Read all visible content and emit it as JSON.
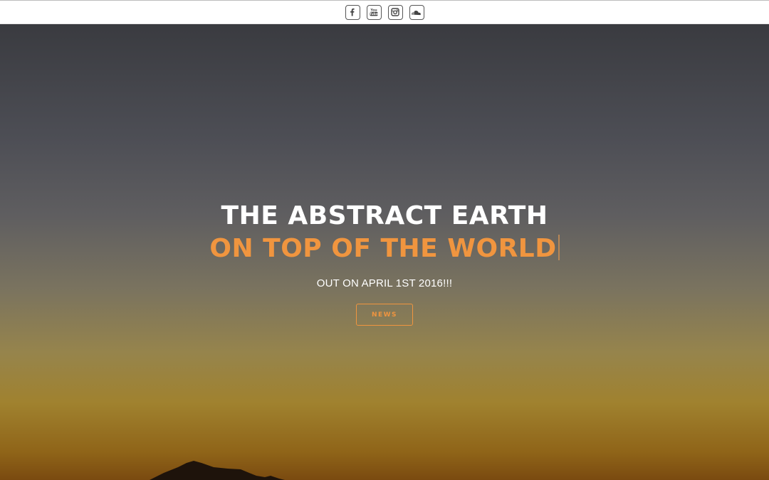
{
  "social_links": [
    {
      "name": "facebook-icon"
    },
    {
      "name": "youtube-icon"
    },
    {
      "name": "instagram-icon"
    },
    {
      "name": "soundcloud-icon"
    }
  ],
  "hero": {
    "title": "THE ABSTRACT EARTH",
    "headline": "ON TOP OF THE WORLD",
    "subtitle": "OUT ON APRIL 1ST 2016!!!",
    "button_label": "NEWS"
  },
  "colors": {
    "accent": "#f0953f",
    "title": "#ffffff",
    "sky_top": "#3a3b40",
    "sky_bottom": "#7a4a10"
  }
}
